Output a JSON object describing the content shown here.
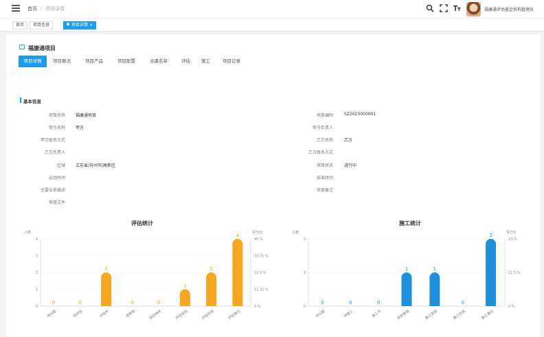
{
  "header": {
    "breadcrumb": [
      "首页",
      "/",
      "项目详情"
    ],
    "username": "福康通评估鉴定机构管理员",
    "tools": [
      "search-icon",
      "fullscreen-icon",
      "font-size-icon"
    ]
  },
  "tags": [
    "首页",
    "项目信息",
    "项目详情"
  ],
  "project": {
    "title": "福康通项目"
  },
  "tabs": [
    "项目详情",
    "项目概况",
    "项目产品",
    "项目配置",
    "派遣名单",
    "评估",
    "施工",
    "项目记录"
  ],
  "section": {
    "title": "基本信息"
  },
  "fields_left": [
    {
      "label": "项目名称",
      "value": "福康通项目"
    },
    {
      "label": "甲方名称",
      "value": "甲方"
    },
    {
      "label": "甲方联系方式",
      "value": ""
    },
    {
      "label": "乙方负责人",
      "value": ""
    },
    {
      "label": "区域",
      "value": "江苏省/苏州市/高新区"
    },
    {
      "label": "启动时间",
      "value": ""
    },
    {
      "label": "主要业务描述",
      "value": ""
    },
    {
      "label": "项目文件",
      "value": ""
    }
  ],
  "fields_right": [
    {
      "label": "项目编码",
      "value": "SZ2023000001"
    },
    {
      "label": "甲方负责人",
      "value": ""
    },
    {
      "label": "乙方名称",
      "value": "乙方"
    },
    {
      "label": "乙方联系方式",
      "value": ""
    },
    {
      "label": "项目状态",
      "value": "进行中"
    },
    {
      "label": "结束时间",
      "value": ""
    },
    {
      "label": "项目备注",
      "value": ""
    }
  ],
  "chart_data": [
    {
      "type": "bar",
      "title": "评估统计",
      "ylabel": "人数",
      "y2label": "百分比",
      "color": "#f5a623",
      "categories": [
        "待分配",
        "待评估",
        "评估中",
        "待审核",
        "驳回待修",
        "评估驳回",
        "评估完成",
        "评估通过"
      ],
      "values": [
        0,
        0,
        2,
        0,
        0,
        1,
        2,
        4
      ],
      "ylim": [
        0,
        4
      ],
      "yticks": [
        "0",
        "1",
        "2",
        "3",
        "4"
      ],
      "y2ticks": [
        "0 %",
        "11.25 %",
        "22.5 %",
        "33.75 %",
        "45 %"
      ],
      "grid": true
    },
    {
      "type": "bar",
      "title": "施工统计",
      "ylabel": "人数",
      "y2label": "百分比",
      "color": "#1e90dc",
      "categories": [
        "待分配",
        "待施工",
        "施工中",
        "验收审核",
        "施工驳回",
        "施工完成",
        "施工通过"
      ],
      "values": [
        0,
        0,
        0,
        1,
        1,
        0,
        2
      ],
      "ylim": [
        0,
        2
      ],
      "yticks": [
        "0",
        "1",
        "2"
      ],
      "y2ticks": [
        "0 %",
        "11.5 %",
        "23 %"
      ],
      "grid": true
    }
  ]
}
